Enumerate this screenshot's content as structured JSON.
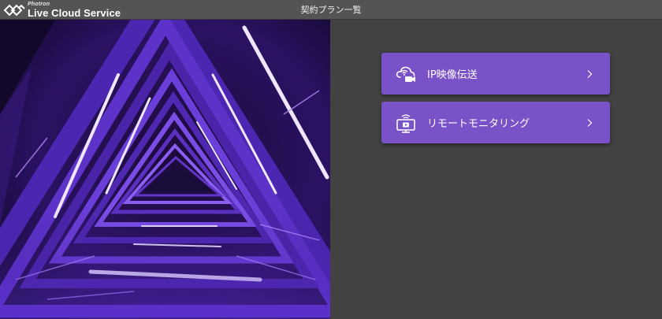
{
  "header": {
    "logo": {
      "top_text": "Photron",
      "main_text": "Live Cloud Service",
      "icon": "photron-logo-icon"
    },
    "title": "契約プラン一覧"
  },
  "hero": {
    "image": "purple-triangular-stairwell-photo"
  },
  "menu": {
    "items": [
      {
        "label": "IP映像伝送",
        "icon": "cloud-camera-icon",
        "chevron": "chevron-right-icon"
      },
      {
        "label": "リモートモニタリング",
        "icon": "monitor-play-icon",
        "chevron": "chevron-right-icon"
      }
    ]
  },
  "colors": {
    "background": "#424242",
    "header_bg": "#545454",
    "button_bg": "#7a52c8",
    "text": "#ffffff"
  }
}
